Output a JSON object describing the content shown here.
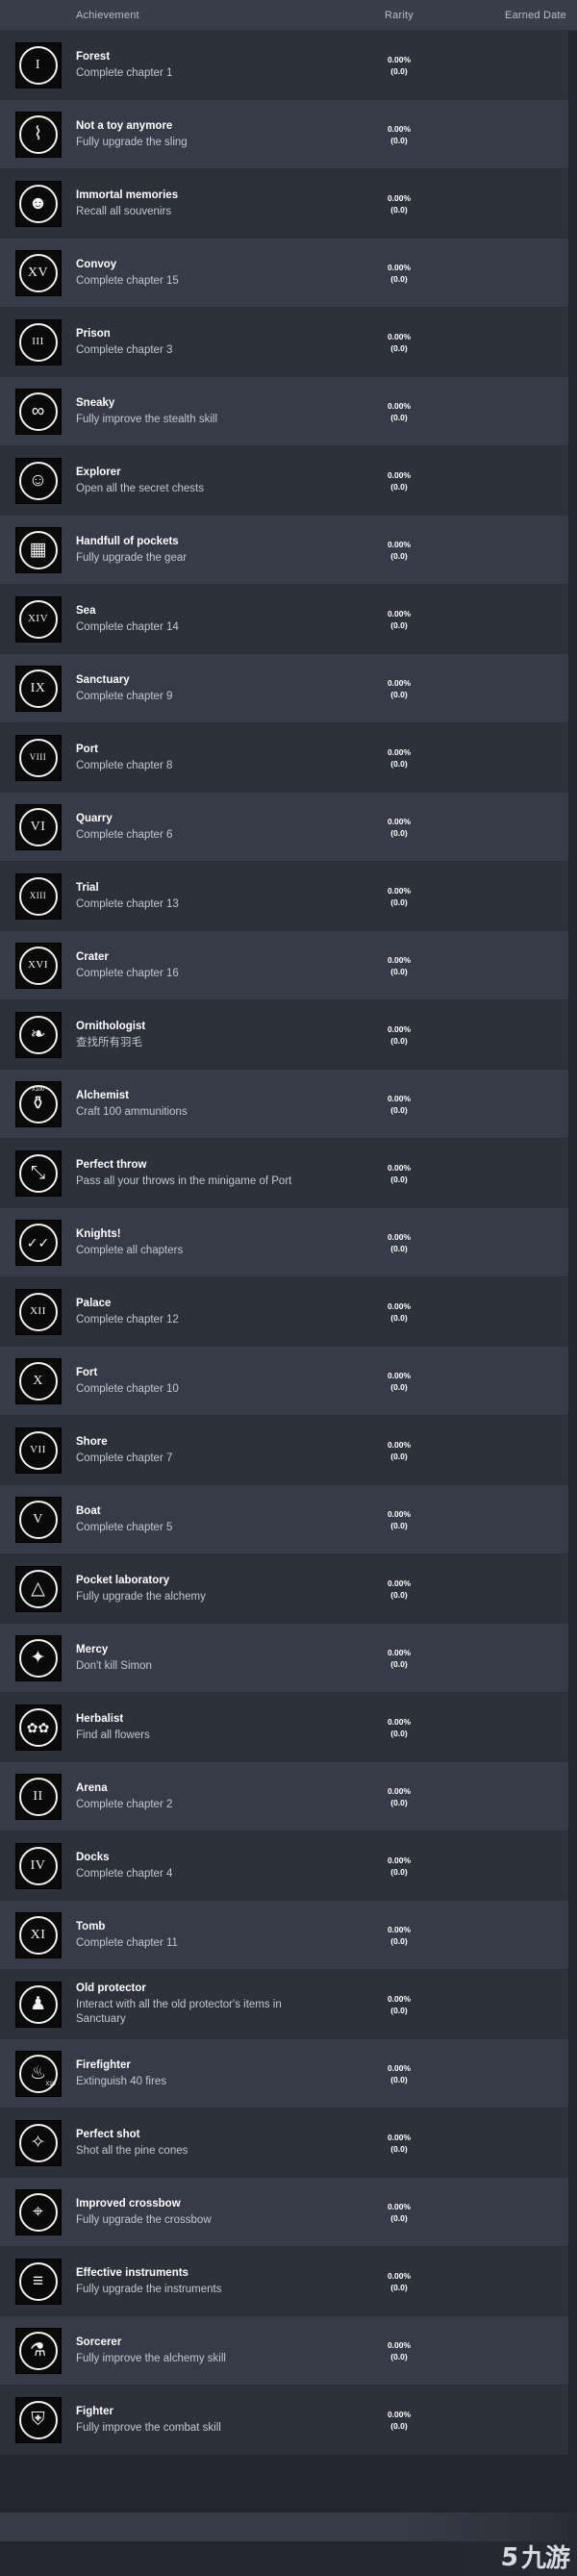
{
  "header": {
    "achievement": "Achievement",
    "rarity": "Rarity",
    "earned_date": "Earned Date"
  },
  "colors": {
    "page_bg": "#23262e",
    "header_bg": "#3a3e4a",
    "row_dark": "#2d313b",
    "row_light": "#373b47",
    "title_text": "#ffffff",
    "desc_text": "#c3c7d0",
    "icon_bg": "#0a0a0a",
    "icon_fg": "#f2f2f2"
  },
  "watermark": {
    "mark": "5",
    "text": "九游"
  },
  "rows": [
    {
      "icon": "roman-numeral-i-icon",
      "roman": "I",
      "glyph": "",
      "badge": "",
      "title": "Forest",
      "desc": "Complete chapter 1",
      "rarity_pct": "0.00%",
      "rarity_count": "(0.0)",
      "earned": ""
    },
    {
      "icon": "slingshot-icon",
      "roman": "",
      "glyph": "⌇",
      "badge": "",
      "title": "Not a toy anymore",
      "desc": "Fully upgrade the sling",
      "rarity_pct": "0.00%",
      "rarity_count": "(0.0)",
      "earned": ""
    },
    {
      "icon": "brain-head-icon",
      "roman": "",
      "glyph": "☻",
      "badge": "",
      "title": "Immortal memories",
      "desc": "Recall all souvenirs",
      "rarity_pct": "0.00%",
      "rarity_count": "(0.0)",
      "earned": ""
    },
    {
      "icon": "roman-numeral-xv-icon",
      "roman": "XV",
      "glyph": "",
      "badge": "",
      "title": "Convoy",
      "desc": "Complete chapter 15",
      "rarity_pct": "0.00%",
      "rarity_count": "(0.0)",
      "earned": ""
    },
    {
      "icon": "roman-numeral-iii-icon",
      "roman": "III",
      "glyph": "",
      "badge": "",
      "title": "Prison",
      "desc": "Complete chapter 3",
      "rarity_pct": "0.00%",
      "rarity_count": "(0.0)",
      "earned": ""
    },
    {
      "icon": "mask-icon",
      "roman": "",
      "glyph": "∞",
      "badge": "",
      "title": "Sneaky",
      "desc": "Fully improve the stealth skill",
      "rarity_pct": "0.00%",
      "rarity_count": "(0.0)",
      "earned": ""
    },
    {
      "icon": "explorer-head-icon",
      "roman": "",
      "glyph": "☺",
      "badge": "",
      "title": "Explorer",
      "desc": "Open all the secret chests",
      "rarity_pct": "0.00%",
      "rarity_count": "(0.0)",
      "earned": ""
    },
    {
      "icon": "pockets-grid-icon",
      "roman": "",
      "glyph": "▦",
      "badge": "",
      "title": "Handfull of pockets",
      "desc": "Fully upgrade the gear",
      "rarity_pct": "0.00%",
      "rarity_count": "(0.0)",
      "earned": ""
    },
    {
      "icon": "roman-numeral-xiv-icon",
      "roman": "XIV",
      "glyph": "",
      "badge": "",
      "title": "Sea",
      "desc": "Complete chapter 14",
      "rarity_pct": "0.00%",
      "rarity_count": "(0.0)",
      "earned": ""
    },
    {
      "icon": "roman-numeral-ix-icon",
      "roman": "IX",
      "glyph": "",
      "badge": "",
      "title": "Sanctuary",
      "desc": "Complete chapter 9",
      "rarity_pct": "0.00%",
      "rarity_count": "(0.0)",
      "earned": ""
    },
    {
      "icon": "roman-numeral-viii-icon",
      "roman": "VIII",
      "glyph": "",
      "badge": "",
      "title": "Port",
      "desc": "Complete chapter 8",
      "rarity_pct": "0.00%",
      "rarity_count": "(0.0)",
      "earned": ""
    },
    {
      "icon": "roman-numeral-vi-icon",
      "roman": "VI",
      "glyph": "",
      "badge": "",
      "title": "Quarry",
      "desc": "Complete chapter 6",
      "rarity_pct": "0.00%",
      "rarity_count": "(0.0)",
      "earned": ""
    },
    {
      "icon": "roman-numeral-xiii-icon",
      "roman": "XIII",
      "glyph": "",
      "badge": "",
      "title": "Trial",
      "desc": "Complete chapter 13",
      "rarity_pct": "0.00%",
      "rarity_count": "(0.0)",
      "earned": ""
    },
    {
      "icon": "roman-numeral-xvi-icon",
      "roman": "XVI",
      "glyph": "",
      "badge": "",
      "title": "Crater",
      "desc": "Complete chapter 16",
      "rarity_pct": "0.00%",
      "rarity_count": "(0.0)",
      "earned": ""
    },
    {
      "icon": "feathers-icon",
      "roman": "",
      "glyph": "❧",
      "badge": "",
      "title": "Ornithologist",
      "desc": "查找所有羽毛",
      "rarity_pct": "0.00%",
      "rarity_count": "(0.0)",
      "earned": ""
    },
    {
      "icon": "ammo-pouch-icon",
      "roman": "",
      "glyph": "⚱",
      "badge": "X100",
      "title": "Alchemist",
      "desc": "Craft 100 ammunitions",
      "rarity_pct": "0.00%",
      "rarity_count": "(0.0)",
      "earned": ""
    },
    {
      "icon": "throwing-knife-icon",
      "roman": "",
      "glyph": "⤡",
      "badge": "",
      "title": "Perfect throw",
      "desc": "Pass all your throws in the minigame of Port",
      "rarity_pct": "0.00%",
      "rarity_count": "(0.0)",
      "earned": ""
    },
    {
      "icon": "checkmarks-icon",
      "roman": "",
      "glyph": "✓✓",
      "badge": "",
      "title": "Knights!",
      "desc": "Complete all chapters",
      "rarity_pct": "0.00%",
      "rarity_count": "(0.0)",
      "earned": ""
    },
    {
      "icon": "roman-numeral-xii-icon",
      "roman": "XII",
      "glyph": "",
      "badge": "",
      "title": "Palace",
      "desc": "Complete chapter 12",
      "rarity_pct": "0.00%",
      "rarity_count": "(0.0)",
      "earned": ""
    },
    {
      "icon": "roman-numeral-x-icon",
      "roman": "X",
      "glyph": "",
      "badge": "",
      "title": "Fort",
      "desc": "Complete chapter 10",
      "rarity_pct": "0.00%",
      "rarity_count": "(0.0)",
      "earned": ""
    },
    {
      "icon": "roman-numeral-vii-icon",
      "roman": "VII",
      "glyph": "",
      "badge": "",
      "title": "Shore",
      "desc": "Complete chapter 7",
      "rarity_pct": "0.00%",
      "rarity_count": "(0.0)",
      "earned": ""
    },
    {
      "icon": "roman-numeral-v-icon",
      "roman": "V",
      "glyph": "",
      "badge": "",
      "title": "Boat",
      "desc": "Complete chapter 5",
      "rarity_pct": "0.00%",
      "rarity_count": "(0.0)",
      "earned": ""
    },
    {
      "icon": "alchemy-triangle-icon",
      "roman": "",
      "glyph": "△",
      "badge": "",
      "title": "Pocket laboratory",
      "desc": "Fully upgrade the alchemy",
      "rarity_pct": "0.00%",
      "rarity_count": "(0.0)",
      "earned": ""
    },
    {
      "icon": "dagger-icon",
      "roman": "",
      "glyph": "✦",
      "badge": "",
      "title": "Mercy",
      "desc": "Don't kill Simon",
      "rarity_pct": "0.00%",
      "rarity_count": "(0.0)",
      "earned": ""
    },
    {
      "icon": "flowers-icon",
      "roman": "",
      "glyph": "✿✿",
      "badge": "",
      "title": "Herbalist",
      "desc": "Find all flowers",
      "rarity_pct": "0.00%",
      "rarity_count": "(0.0)",
      "earned": ""
    },
    {
      "icon": "roman-numeral-ii-icon",
      "roman": "II",
      "glyph": "",
      "badge": "",
      "title": "Arena",
      "desc": "Complete chapter 2",
      "rarity_pct": "0.00%",
      "rarity_count": "(0.0)",
      "earned": ""
    },
    {
      "icon": "roman-numeral-iv-icon",
      "roman": "IV",
      "glyph": "",
      "badge": "",
      "title": "Docks",
      "desc": "Complete chapter 4",
      "rarity_pct": "0.00%",
      "rarity_count": "(0.0)",
      "earned": ""
    },
    {
      "icon": "roman-numeral-xi-icon",
      "roman": "XI",
      "glyph": "",
      "badge": "",
      "title": "Tomb",
      "desc": "Complete chapter 11",
      "rarity_pct": "0.00%",
      "rarity_count": "(0.0)",
      "earned": ""
    },
    {
      "icon": "ghost-figure-icon",
      "roman": "",
      "glyph": "♟",
      "badge": "",
      "title": "Old protector",
      "desc": "Interact with all the old protector's items in Sanctuary",
      "rarity_pct": "0.00%",
      "rarity_count": "(0.0)",
      "earned": ""
    },
    {
      "icon": "fire-icon",
      "roman": "",
      "glyph": "♨",
      "badge": "X10",
      "title": "Firefighter",
      "desc": "Extinguish 40 fires",
      "rarity_pct": "0.00%",
      "rarity_count": "(0.0)",
      "earned": ""
    },
    {
      "icon": "pine-cone-icon",
      "roman": "",
      "glyph": "✧",
      "badge": "",
      "title": "Perfect shot",
      "desc": "Shot all the pine cones",
      "rarity_pct": "0.00%",
      "rarity_count": "(0.0)",
      "earned": ""
    },
    {
      "icon": "crossbow-icon",
      "roman": "",
      "glyph": "⌖",
      "badge": "",
      "title": "Improved crossbow",
      "desc": "Fully upgrade the crossbow",
      "rarity_pct": "0.00%",
      "rarity_count": "(0.0)",
      "earned": ""
    },
    {
      "icon": "instruments-icon",
      "roman": "",
      "glyph": "≡",
      "badge": "",
      "title": "Effective instruments",
      "desc": "Fully upgrade the instruments",
      "rarity_pct": "0.00%",
      "rarity_count": "(0.0)",
      "earned": ""
    },
    {
      "icon": "potion-flask-icon",
      "roman": "",
      "glyph": "⚗",
      "badge": "",
      "title": "Sorcerer",
      "desc": "Fully improve the alchemy skill",
      "rarity_pct": "0.00%",
      "rarity_count": "(0.0)",
      "earned": ""
    },
    {
      "icon": "knight-shield-icon",
      "roman": "",
      "glyph": "⛨",
      "badge": "",
      "title": "Fighter",
      "desc": "Fully improve the combat skill",
      "rarity_pct": "0.00%",
      "rarity_count": "(0.0)",
      "earned": ""
    }
  ]
}
